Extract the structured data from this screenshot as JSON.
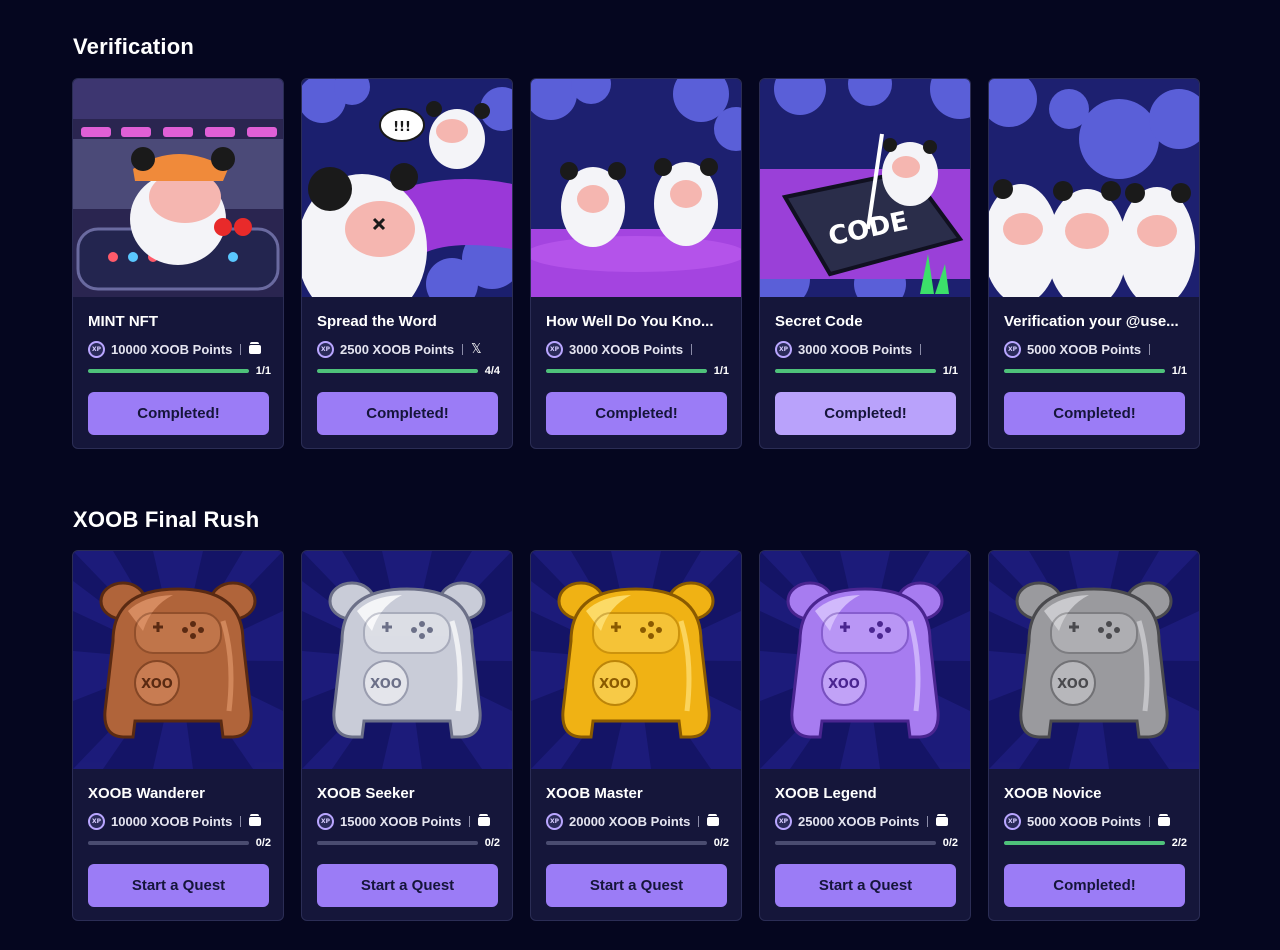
{
  "sections": [
    {
      "title": "Verification",
      "cards": [
        {
          "title": "MINT NFT",
          "points": "10000 XOOB Points",
          "platform": "wallet-icon",
          "progress_label": "1/1",
          "progress": 1.0,
          "button": "Completed!",
          "art": "scene-dj"
        },
        {
          "title": "Spread the Word",
          "points": "2500 XOOB Points",
          "platform": "x-logo-icon",
          "progress_label": "4/4",
          "progress": 1.0,
          "button": "Completed!",
          "art": "scene-speech"
        },
        {
          "title": "How Well Do You Kno...",
          "points": "3000 XOOB Points",
          "platform": "",
          "progress_label": "1/1",
          "progress": 1.0,
          "button": "Completed!",
          "art": "scene-duo"
        },
        {
          "title": "Secret Code",
          "points": "3000 XOOB Points",
          "platform": "",
          "progress_label": "1/1",
          "progress": 1.0,
          "button": "Completed!",
          "art": "scene-code"
        },
        {
          "title": "Verification your @use...",
          "points": "5000 XOOB Points",
          "platform": "",
          "progress_label": "1/1",
          "progress": 1.0,
          "button": "Completed!",
          "art": "scene-trio"
        }
      ]
    },
    {
      "title": "XOOB Final Rush",
      "cards": [
        {
          "title": "XOOB Wanderer",
          "points": "10000 XOOB Points",
          "platform": "wallet-icon",
          "progress_label": "0/2",
          "progress": 0.0,
          "button": "Start a Quest",
          "art": "mascot-bronze"
        },
        {
          "title": "XOOB Seeker",
          "points": "15000 XOOB Points",
          "platform": "wallet-icon",
          "progress_label": "0/2",
          "progress": 0.0,
          "button": "Start a Quest",
          "art": "mascot-silver"
        },
        {
          "title": "XOOB Master",
          "points": "20000 XOOB Points",
          "platform": "wallet-icon",
          "progress_label": "0/2",
          "progress": 0.0,
          "button": "Start a Quest",
          "art": "mascot-gold"
        },
        {
          "title": "XOOB Legend",
          "points": "25000 XOOB Points",
          "platform": "wallet-icon",
          "progress_label": "0/2",
          "progress": 0.0,
          "button": "Start a Quest",
          "art": "mascot-purple"
        },
        {
          "title": "XOOB Novice",
          "points": "5000 XOOB Points",
          "platform": "wallet-icon",
          "progress_label": "2/2",
          "progress": 1.0,
          "button": "Completed!",
          "art": "mascot-stone"
        }
      ]
    }
  ],
  "points_icon_label": "XP",
  "colors": {
    "page_bg": "#05061f",
    "card_bg": "#15163a",
    "button": "#9b7cf6",
    "progress_fill": "#4ec27a",
    "progress_track": "#4a4c70",
    "bronze": "#b0643a",
    "silver": "#c9ccd8",
    "gold": "#f0b214",
    "purple": "#a77cf0",
    "stone": "#9a9a9e"
  }
}
